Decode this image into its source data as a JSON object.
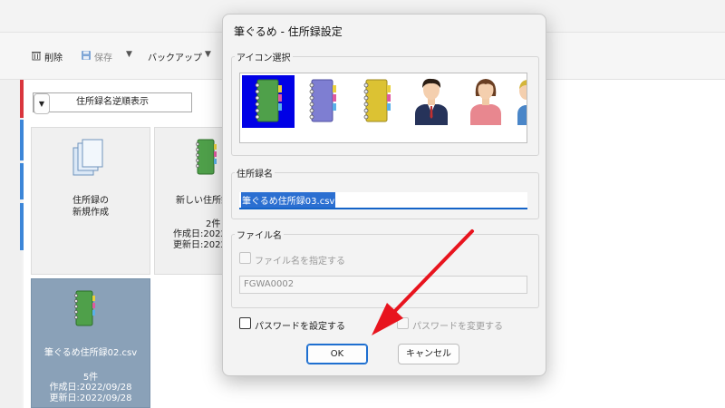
{
  "toolbar": {
    "delete_label": "削除",
    "save_label": "保存",
    "backup_label": "バックアップ"
  },
  "sort": {
    "value": "住所録名逆順表示"
  },
  "cards": [
    {
      "label": "住所録の\n新規作成"
    },
    {
      "label": "新しい住所録",
      "count": "2件",
      "created": "作成日:2022",
      "updated": "更新日:2022"
    },
    {
      "label": "筆ぐるめ住所録02.csv",
      "count": "5件",
      "created": "作成日:2022/09/28",
      "updated": "更新日:2022/09/28"
    }
  ],
  "dialog": {
    "title": "筆ぐるめ - 住所録設定",
    "icon_group_label": "アイコン選択",
    "name_group_label": "住所録名",
    "name_value": "筆ぐるめ住所録03.csv",
    "file_group_label": "ファイル名",
    "file_checkbox_label": "ファイル名を指定する",
    "file_value": "FGWA0002",
    "password_set_label": "パスワードを設定する",
    "password_change_label": "パスワードを変更する",
    "ok_label": "OK",
    "cancel_label": "キャンセル",
    "icons": [
      "green-notebook-icon",
      "purple-notebook-icon",
      "yellow-notebook-icon",
      "man-icon",
      "woman-icon",
      "person-partial-icon"
    ]
  },
  "colors": {
    "accent": "#1e6fd0",
    "selection": "#0000e6",
    "arrow": "#e8141e",
    "selected_card": "#8aa1b8"
  }
}
